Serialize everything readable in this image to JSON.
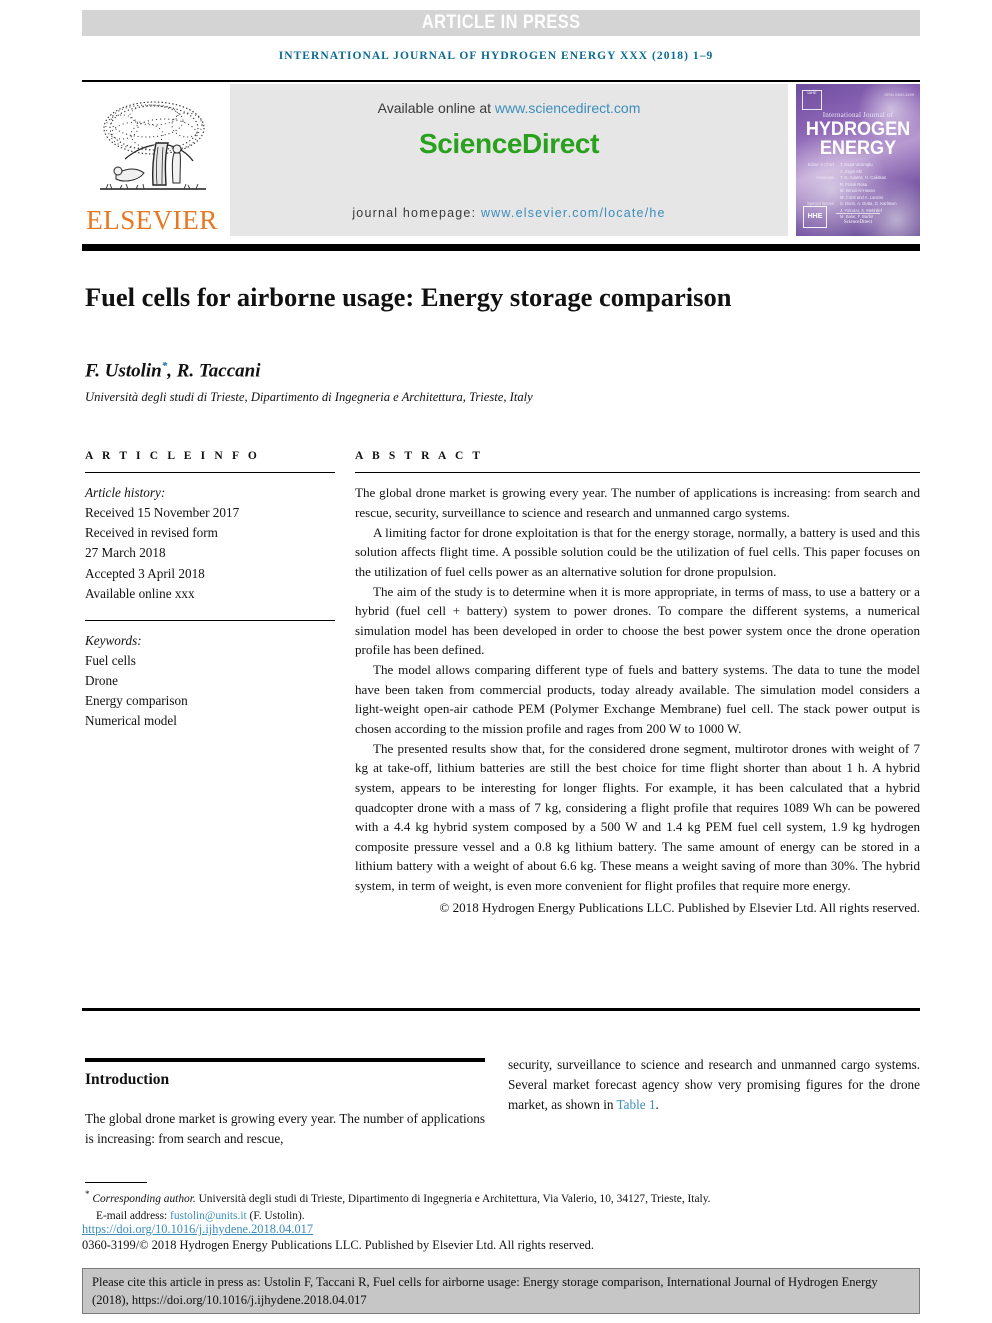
{
  "banner": {
    "text": "ARTICLE IN PRESS"
  },
  "running_head": "INTERNATIONAL JOURNAL OF HYDROGEN ENERGY XXX (2018) 1–9",
  "masthead": {
    "publisher": "ELSEVIER",
    "available_prefix": "Available online at ",
    "available_url": "www.sciencedirect.com",
    "sciencedirect_logo": "ScienceDirect",
    "homepage_prefix": "journal homepage: ",
    "homepage_url": "www.elsevier.com/locate/he",
    "cover": {
      "issn": "ISSN 0360-3199",
      "badge_left": "IAHE",
      "small_line": "International Journal of",
      "line1": "HYDROGEN",
      "line2": "ENERGY",
      "badge_bottom": "HHE",
      "sciencedirect": "ScienceDirect",
      "credits": [
        {
          "label": "Editor in Chief",
          "value": "T. Nejat Veziroglu"
        },
        {
          "label": "Founding Editor",
          "value": "A. Ergin Alti"
        },
        {
          "label": "Associate Editors",
          "value": "T. D. Adams, H. Caliskan"
        },
        {
          "label": "",
          "value": "R. Frank Rosa"
        },
        {
          "label": "",
          "value": "M. Ismail Al-Hasan"
        },
        {
          "label": "",
          "value": "M. Conti and A. Lanzini"
        },
        {
          "label": "Special Issues",
          "value": "S. Dunn, A. Dutta, G. Karlsson"
        },
        {
          "label": "",
          "value": "J. Yolcular, S. Mekhilef"
        },
        {
          "label": "",
          "value": "M. Balat, F. Barbir"
        }
      ]
    }
  },
  "article": {
    "title": "Fuel cells for airborne usage: Energy storage comparison",
    "authors": "F. Ustolin, R. Taccani",
    "author_marker": "*",
    "affiliation": "Università degli studi di Trieste, Dipartimento di Ingegneria e Architettura, Trieste, Italy"
  },
  "article_info": {
    "heading": "A R T I C L E   I N F O",
    "history_label": "Article history:",
    "history": [
      "Received 15 November 2017",
      "Received in revised form",
      "27 March 2018",
      "Accepted 3 April 2018",
      "Available online xxx"
    ],
    "keywords_label": "Keywords:",
    "keywords": [
      "Fuel cells",
      "Drone",
      "Energy comparison",
      "Numerical model"
    ]
  },
  "abstract": {
    "heading": "A B S T R A C T",
    "paragraphs": [
      "The global drone market is growing every year. The number of applications is increasing: from search and rescue, security, surveillance to science and research and unmanned cargo systems.",
      "A limiting factor for drone exploitation is that for the energy storage, normally, a battery is used and this solution affects flight time. A possible solution could be the utilization of fuel cells. This paper focuses on the utilization of fuel cells power as an alternative solution for drone propulsion.",
      "The aim of the study is to determine when it is more appropriate, in terms of mass, to use a battery or a hybrid (fuel cell + battery) system to power drones. To compare the different systems, a numerical simulation model has been developed in order to choose the best power system once the drone operation profile has been defined.",
      "The model allows comparing different type of fuels and battery systems. The data to tune the model have been taken from commercial products, today already available. The simulation model considers a light-weight open-air cathode PEM (Polymer Exchange Membrane) fuel cell. The stack power output is chosen according to the mission profile and rages from 200 W to 1000 W.",
      "The presented results show that, for the considered drone segment, multirotor drones with weight of 7 kg at take-off, lithium batteries are still the best choice for time flight shorter than about 1 h. A hybrid system, appears to be interesting for longer flights. For example, it has been calculated that a hybrid quadcopter drone with a mass of 7 kg, considering a flight profile that requires 1089 Wh can be powered with a 4.4 kg hybrid system composed by a 500 W and 1.4 kg PEM fuel cell system, 1.9 kg hydrogen composite pressure vessel and a 0.8 kg lithium battery. The same amount of energy can be stored in a lithium battery with a weight of about 6.6 kg. These means a weight saving of more than 30%. The hybrid system, in term of weight, is even more convenient for flight profiles that require more energy."
    ],
    "copyright": "© 2018 Hydrogen Energy Publications LLC. Published by Elsevier Ltd. All rights reserved."
  },
  "introduction": {
    "heading": "Introduction",
    "column_left": "The global drone market is growing every year. The number of applications is increasing: from search and rescue,",
    "column_right_a": "security, surveillance to science and research and unmanned cargo systems. Several market forecast agency show very promising figures for the drone market, as shown in ",
    "column_right_link": "Table 1",
    "column_right_b": "."
  },
  "footnote": {
    "marker": "*",
    "corresponding_label": "Corresponding author.",
    "corresponding_address": " Università degli studi di Trieste, Dipartimento di Ingegneria e Architettura, Via Valerio, 10, 34127, Trieste, Italy.",
    "email_label": "E-mail address: ",
    "email": "fustolin@units.it",
    "email_suffix": " (F. Ustolin).",
    "doi": "https://doi.org/10.1016/j.ijhydene.2018.04.017",
    "issn_line": "0360-3199/© 2018 Hydrogen Energy Publications LLC. Published by Elsevier Ltd. All rights reserved."
  },
  "cite_box": {
    "text": "Please cite this article in press as: Ustolin F, Taccani R, Fuel cells for airborne usage: Energy storage comparison, International Journal of Hydrogen Energy (2018), https://doi.org/10.1016/j.ijhydene.2018.04.017"
  },
  "colors": {
    "banner_bg": "#d4d4d4",
    "running_head": "#0b6a94",
    "link": "#3c8dbc",
    "elsevier_orange": "#e87722",
    "sciencedirect_green": "#2aa11e",
    "cite_box_bg": "#c6c6c6"
  }
}
